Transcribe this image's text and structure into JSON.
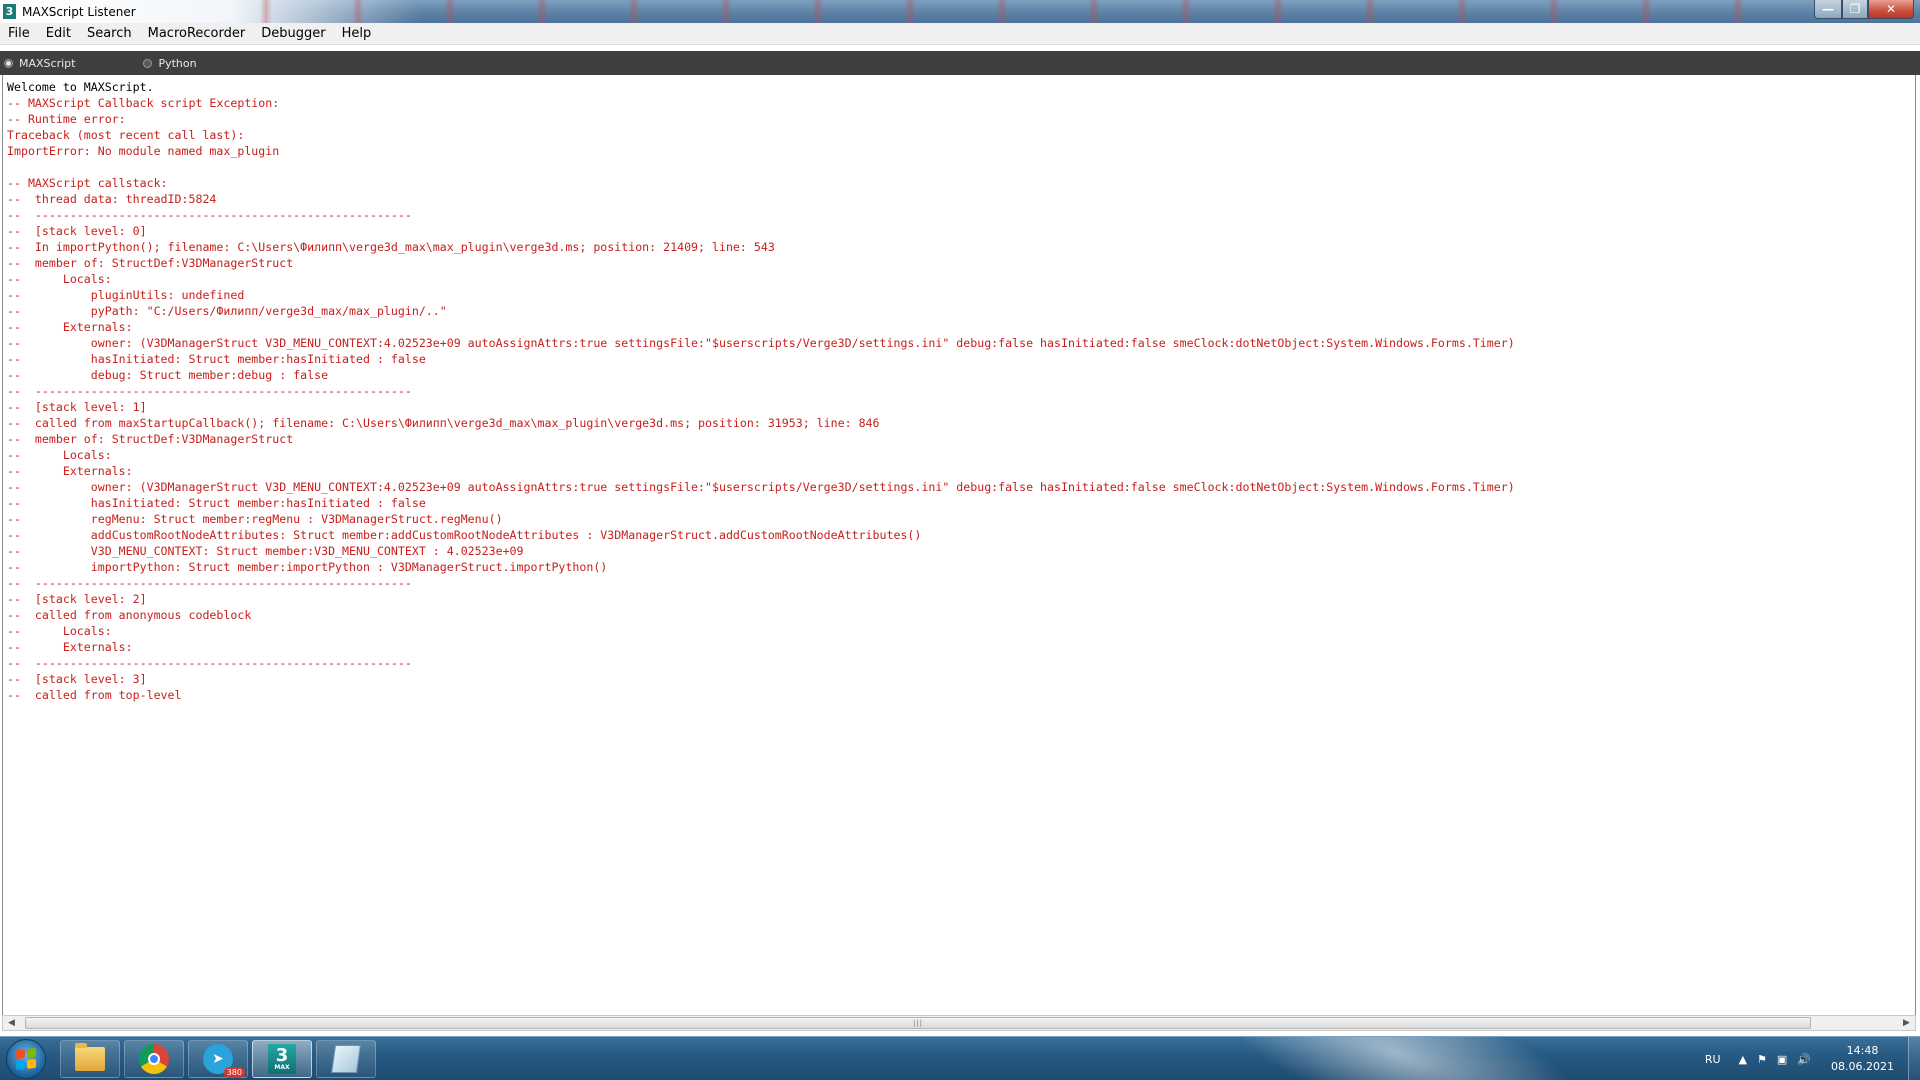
{
  "window": {
    "title": "MAXScript Listener",
    "app_icon_glyph": "3"
  },
  "menu": [
    "File",
    "Edit",
    "Search",
    "MacroRecorder",
    "Debugger",
    "Help"
  ],
  "modes": {
    "maxscript": "MAXScript",
    "python": "Python",
    "selected": "MAXScript"
  },
  "listener": {
    "welcome": "Welcome to MAXScript.",
    "output": "\n-- MAXScript Callback script Exception:\n-- Runtime error:\nTraceback (most recent call last):\nImportError: No module named max_plugin\n\n-- MAXScript callstack:\n--  thread data: threadID:5824\n--  ------------------------------------------------------\n--  [stack level: 0]\n--  In importPython(); filename: C:\\Users\\Филипп\\verge3d_max\\max_plugin\\verge3d.ms; position: 21409; line: 543\n--  member of: StructDef:V3DManagerStruct\n--      Locals:\n--          pluginUtils: undefined\n--          pyPath: \"C:/Users/Филипп/verge3d_max/max_plugin/..\"\n--      Externals:\n--          owner: (V3DManagerStruct V3D_MENU_CONTEXT:4.02523e+09 autoAssignAttrs:true settingsFile:\"$userscripts/Verge3D/settings.ini\" debug:false hasInitiated:false smeClock:dotNetObject:System.Windows.Forms.Timer)\n--          hasInitiated: Struct member:hasInitiated : false\n--          debug: Struct member:debug : false\n--  ------------------------------------------------------\n--  [stack level: 1]\n--  called from maxStartupCallback(); filename: C:\\Users\\Филипп\\verge3d_max\\max_plugin\\verge3d.ms; position: 31953; line: 846\n--  member of: StructDef:V3DManagerStruct\n--      Locals:\n--      Externals:\n--          owner: (V3DManagerStruct V3D_MENU_CONTEXT:4.02523e+09 autoAssignAttrs:true settingsFile:\"$userscripts/Verge3D/settings.ini\" debug:false hasInitiated:false smeClock:dotNetObject:System.Windows.Forms.Timer)\n--          hasInitiated: Struct member:hasInitiated : false\n--          regMenu: Struct member:regMenu : V3DManagerStruct.regMenu()\n--          addCustomRootNodeAttributes: Struct member:addCustomRootNodeAttributes : V3DManagerStruct.addCustomRootNodeAttributes()\n--          V3D_MENU_CONTEXT: Struct member:V3D_MENU_CONTEXT : 4.02523e+09\n--          importPython: Struct member:importPython : V3DManagerStruct.importPython()\n--  ------------------------------------------------------\n--  [stack level: 2]\n--  called from anonymous codeblock\n--      Locals:\n--      Externals:\n--  ------------------------------------------------------\n--  [stack level: 3]\n--  called from top-level"
  },
  "colors": {
    "error_text": "#c8201c",
    "welcome_text": "#000000",
    "mode_bar_bg": "#3f3f3f"
  },
  "taskbar": {
    "apps": [
      {
        "name": "explorer",
        "icon": "folder-icon"
      },
      {
        "name": "chrome",
        "icon": "chrome-icon"
      },
      {
        "name": "telegram",
        "icon": "telegram-icon",
        "badge": "380"
      },
      {
        "name": "3ds-max",
        "icon": "max-icon",
        "glyph": "3",
        "sub": "MAX",
        "active": true
      },
      {
        "name": "notepad",
        "icon": "notepad-icon"
      }
    ],
    "tray": {
      "language": "RU",
      "time": "14:48",
      "date": "08.06.2021"
    }
  }
}
